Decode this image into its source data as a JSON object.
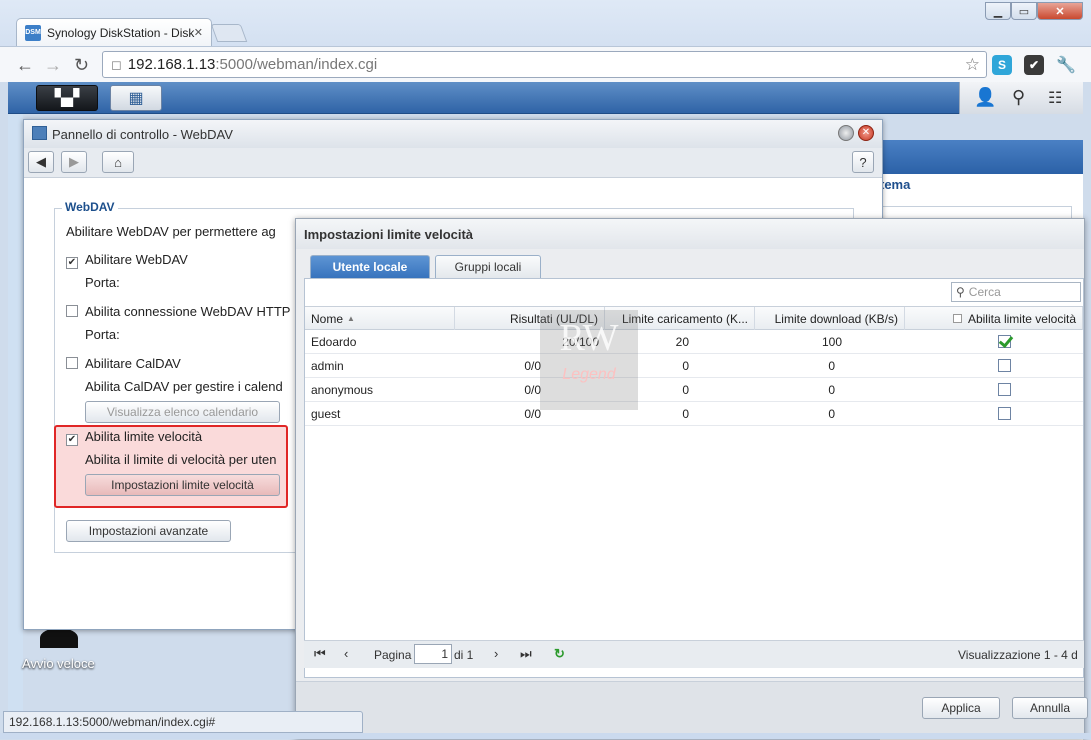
{
  "browser": {
    "tab_title": "Synology DiskStation - Disk",
    "url_host": "192.168.1.13",
    "url_path": ":5000/webman/index.cgi",
    "status_url": "192.168.1.13:5000/webman/index.cgi#"
  },
  "desktop": {
    "quick_launch_label": "Avvio veloce",
    "bg_window_text": "tema"
  },
  "control_panel": {
    "title": "Pannello di controllo - WebDAV",
    "help_label": "?",
    "section_title": "WebDAV",
    "intro": "Abilitare WebDAV per permettere ag",
    "enable_webdav": {
      "label": "Abilitare WebDAV",
      "checked": true
    },
    "port_label_1": "Porta:",
    "enable_https": {
      "label": "Abilita connessione WebDAV HTTP",
      "checked": false
    },
    "port_label_2": "Porta:",
    "enable_caldav": {
      "label": "Abilitare CalDAV",
      "checked": false
    },
    "caldav_desc": "Abilita CalDAV per gestire i calend",
    "calendar_button": "Visualizza elenco calendario",
    "enable_speed_limit": {
      "label": "Abilita limite velocità",
      "checked": true
    },
    "speed_limit_desc": "Abilita il limite di velocità per uten",
    "speed_limit_button": "Impostazioni limite velocità",
    "advanced_button": "Impostazioni avanzate"
  },
  "dialog": {
    "title": "Impostazioni limite velocità",
    "tabs": [
      {
        "label": "Utente locale",
        "active": true
      },
      {
        "label": "Gruppi locali",
        "active": false
      }
    ],
    "search_placeholder": "Cerca",
    "columns": [
      "Nome",
      "Risultati (UL/DL)",
      "Limite caricamento (K...",
      "Limite download (KB/s)",
      "Abilita limite velocità"
    ],
    "rows": [
      {
        "name": "Edoardo",
        "result": "20/100",
        "upload": "20",
        "download": "100",
        "enabled": true
      },
      {
        "name": "admin",
        "result": "0/0",
        "upload": "0",
        "download": "0",
        "enabled": false
      },
      {
        "name": "anonymous",
        "result": "0/0",
        "upload": "0",
        "download": "0",
        "enabled": false
      },
      {
        "name": "guest",
        "result": "0/0",
        "upload": "0",
        "download": "0",
        "enabled": false
      }
    ],
    "pager": {
      "page_label": "Pagina",
      "page_value": "1",
      "of_label": "di 1",
      "display_text": "Visualizzazione 1 - 4 d"
    },
    "apply_button": "Applica",
    "cancel_button": "Annulla"
  },
  "watermark": {
    "top": "RW",
    "bottom": "Legend"
  }
}
